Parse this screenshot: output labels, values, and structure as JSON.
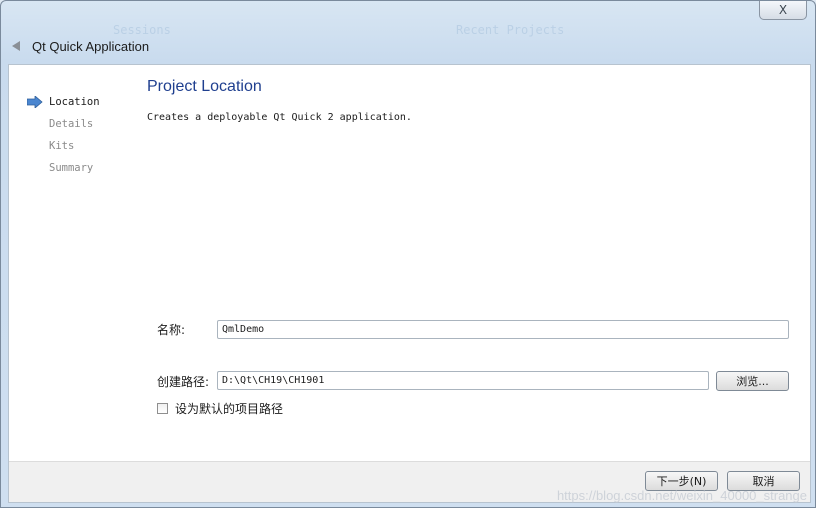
{
  "background": {
    "left_tab": "Sessions",
    "right_tab": "Recent Projects"
  },
  "window": {
    "close_label": "X",
    "title": "Qt Quick Application"
  },
  "sidebar": {
    "items": [
      {
        "label": "Location",
        "active": true
      },
      {
        "label": "Details",
        "active": false
      },
      {
        "label": "Kits",
        "active": false
      },
      {
        "label": "Summary",
        "active": false
      }
    ]
  },
  "main": {
    "title": "Project Location",
    "description": "Creates a deployable Qt Quick 2 application.",
    "name_label": "名称:",
    "name_value": "QmlDemo",
    "path_label": "创建路径:",
    "path_value": "D:\\Qt\\CH19\\CH1901",
    "browse_label": "浏览...",
    "default_path_label": "设为默认的项目路径",
    "default_path_checked": false
  },
  "footer": {
    "next_label": "下一步(N)",
    "cancel_label": "取消"
  },
  "watermark": "https://blog.csdn.net/weixin_40000_strange",
  "colors": {
    "title_blue": "#1f3f8f",
    "arrow_blue": "#4a86d0"
  }
}
